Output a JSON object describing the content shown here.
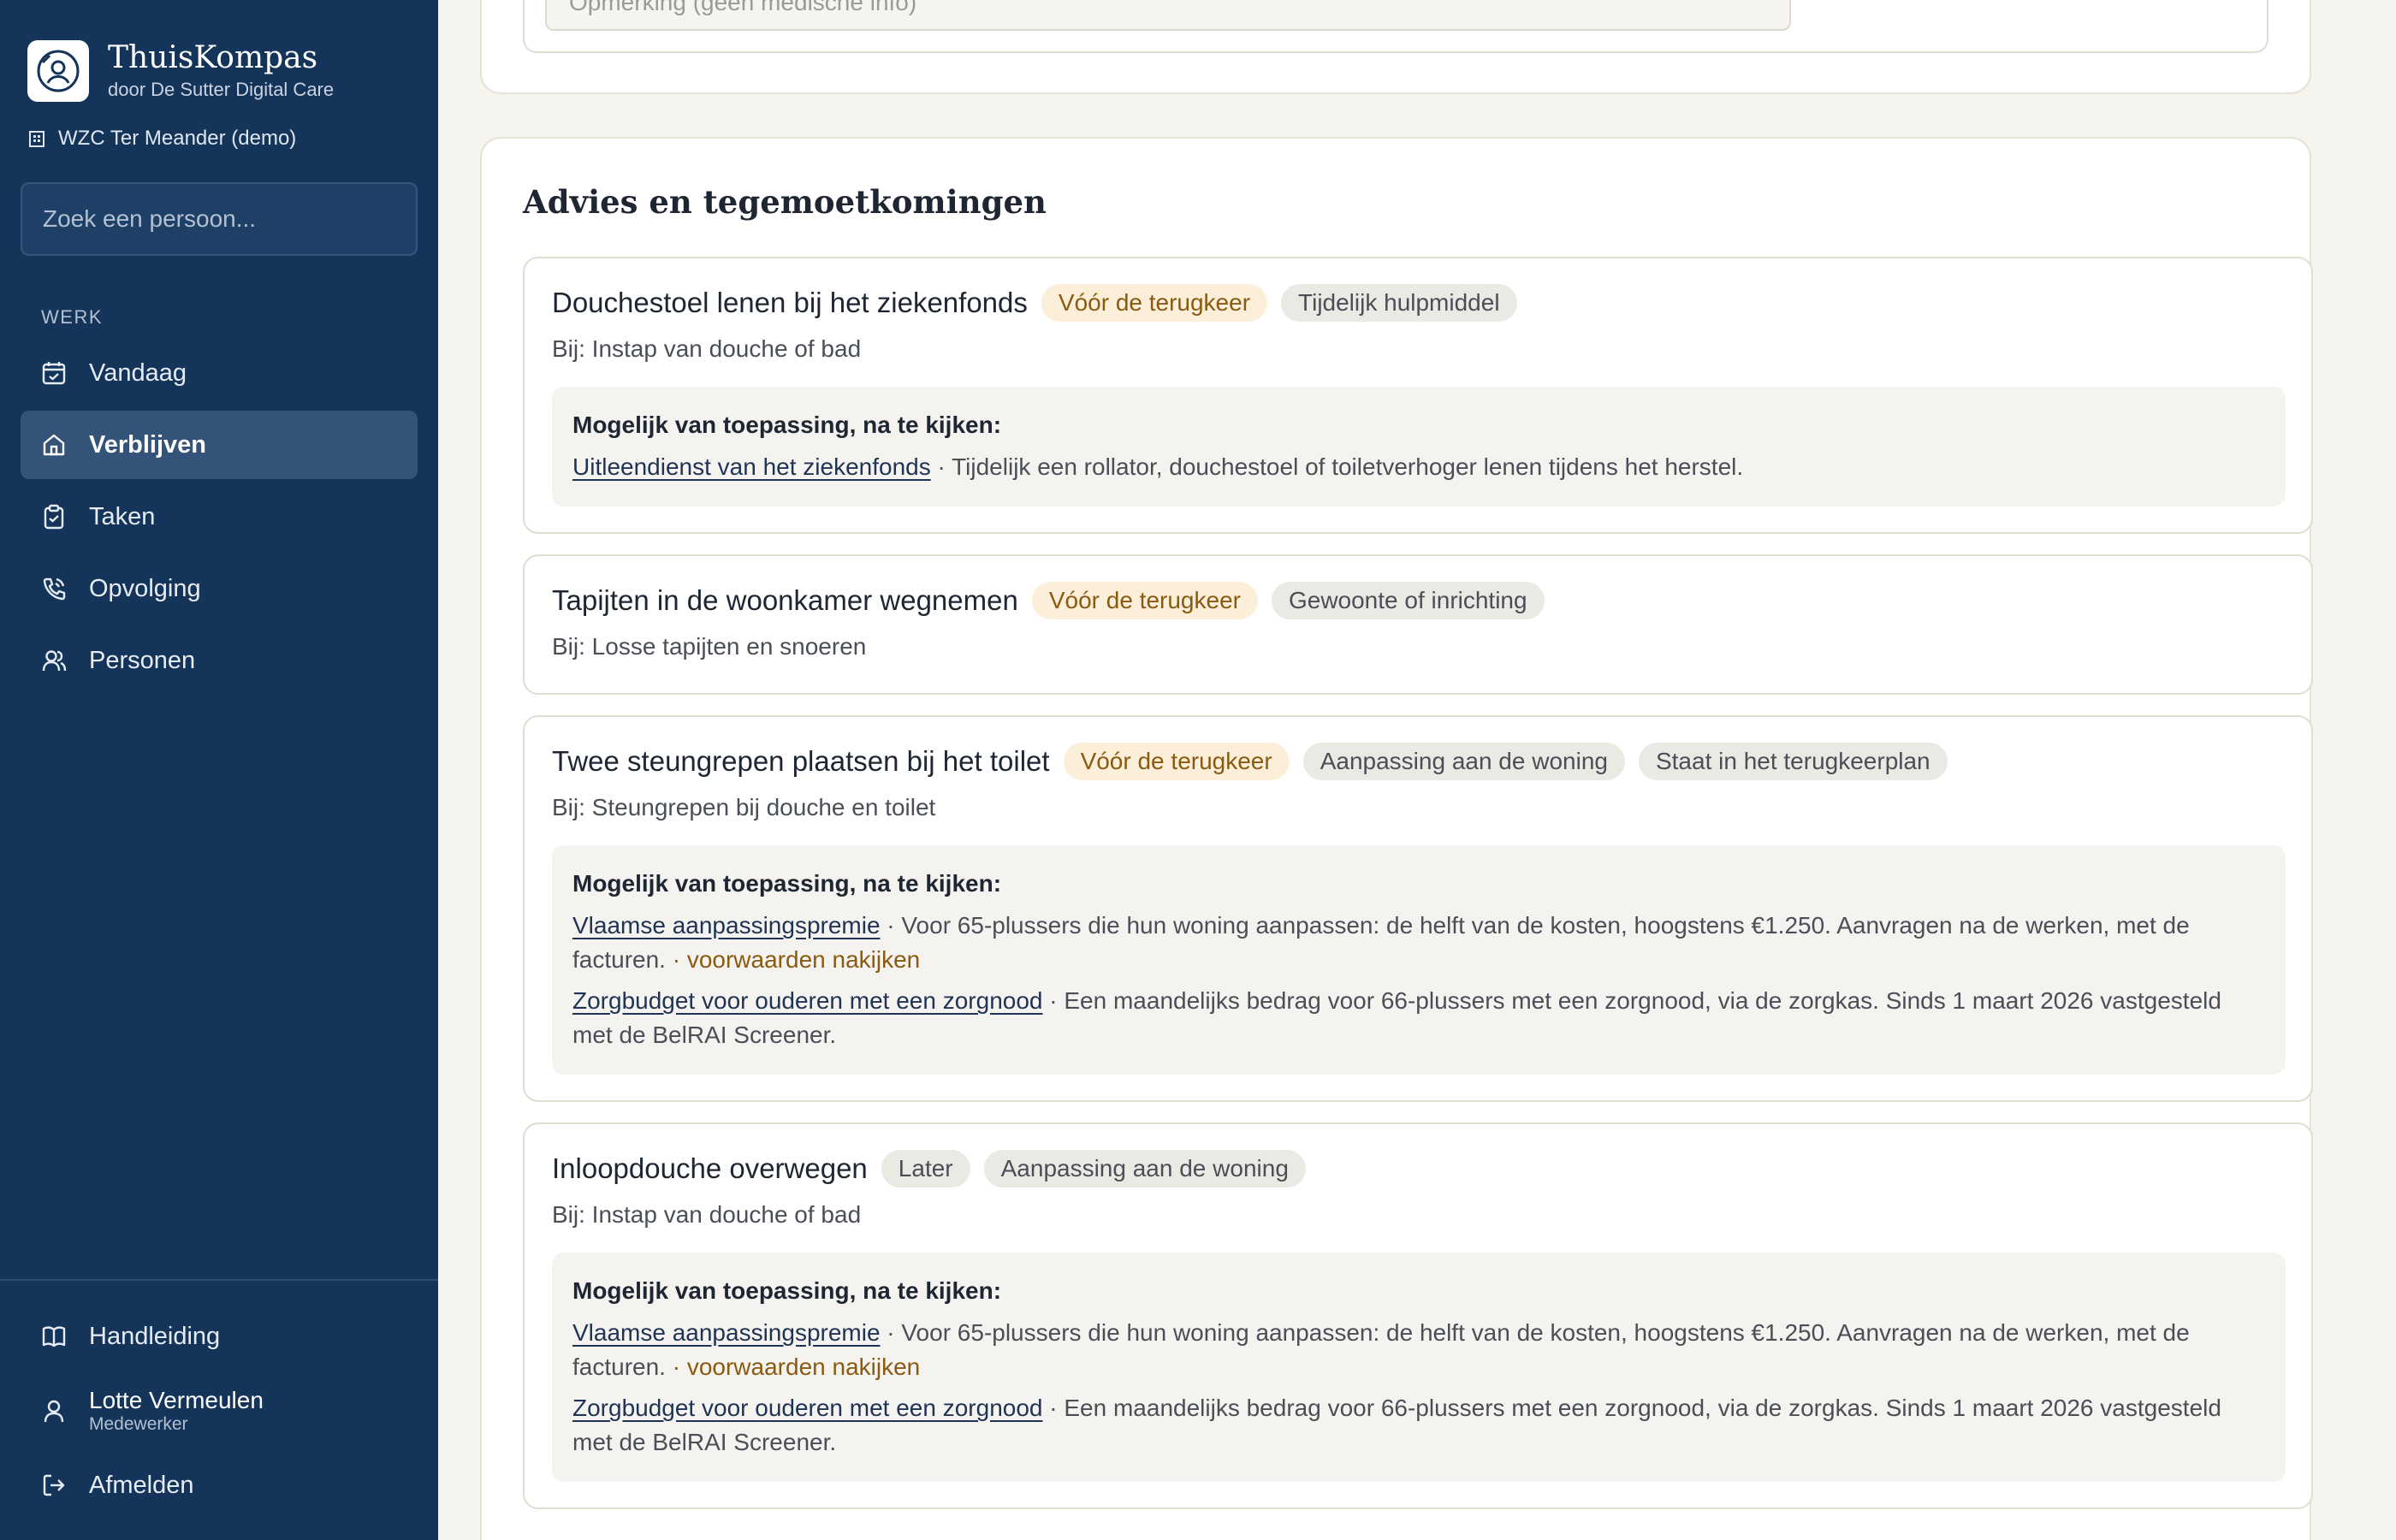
{
  "brand": {
    "title": "ThuisKompas",
    "subtitle": "door De Sutter Digital Care"
  },
  "org": {
    "name": "WZC Ter Meander (demo)"
  },
  "search": {
    "placeholder": "Zoek een persoon..."
  },
  "nav": {
    "section": "WERK",
    "items": [
      {
        "label": "Vandaag",
        "icon": "calendar-check-icon"
      },
      {
        "label": "Verblijven",
        "icon": "home-icon",
        "active": true
      },
      {
        "label": "Taken",
        "icon": "clipboard-check-icon"
      },
      {
        "label": "Opvolging",
        "icon": "phone-icon"
      },
      {
        "label": "Personen",
        "icon": "users-icon"
      }
    ]
  },
  "footer": {
    "manual": "Handleiding",
    "user": {
      "name": "Lotte Vermeulen",
      "role": "Medewerker"
    },
    "logout": "Afmelden"
  },
  "top": {
    "remark_placeholder": "Opmerking (geen medische info)"
  },
  "advice": {
    "title": "Advies en tegemoetkomingen",
    "options_heading": "Mogelijk van toepassing, na te kijken:",
    "items": [
      {
        "title": "Douchestoel lenen bij het ziekenfonds",
        "tags": [
          "Vóór de terugkeer",
          "Tijdelijk hulpmiddel"
        ],
        "sub": "Bij: Instap van douche of bad",
        "options": [
          {
            "link": "Uitleendienst van het ziekenfonds",
            "text": " · Tijdelijk een rollator, douchestoel of toiletverhoger lenen tijdens het herstel."
          }
        ]
      },
      {
        "title": "Tapijten in de woonkamer wegnemen",
        "tags": [
          "Vóór de terugkeer",
          "Gewoonte of inrichting"
        ],
        "sub": "Bij: Losse tapijten en snoeren"
      },
      {
        "title": "Twee steungrepen plaatsen bij het toilet",
        "tags": [
          "Vóór de terugkeer",
          "Aanpassing aan de woning",
          "Staat in het terugkeerplan"
        ],
        "sub": "Bij: Steungrepen bij douche en toilet",
        "options": [
          {
            "link": "Vlaamse aanpassingspremie",
            "text": " · Voor 65-plussers die hun woning aanpassen: de helft van de kosten, hoogstens €1.250. Aanvragen na de werken, met de facturen.",
            "cond": " · voorwaarden nakijken"
          },
          {
            "link": "Zorgbudget voor ouderen met een zorgnood",
            "text": " · Een maandelijks bedrag voor 66-plussers met een zorgnood, via de zorgkas. Sinds 1 maart 2026 vastgesteld met de BelRAI Screener."
          }
        ]
      },
      {
        "title": "Inloopdouche overwegen",
        "tags": [
          "Later",
          "Aanpassing aan de woning"
        ],
        "sub": "Bij: Instap van douche of bad",
        "options": [
          {
            "link": "Vlaamse aanpassingspremie",
            "text": " · Voor 65-plussers die hun woning aanpassen: de helft van de kosten, hoogstens €1.250. Aanvragen na de werken, met de facturen.",
            "cond": " · voorwaarden nakijken"
          },
          {
            "link": "Zorgbudget voor ouderen met een zorgnood",
            "text": " · Een maandelijks bedrag voor 66-plussers met een zorgnood, via de zorgkas. Sinds 1 maart 2026 vastgesteld met de BelRAI Screener."
          }
        ]
      }
    ]
  },
  "colors": {
    "sidebar": "#15345a",
    "active_nav": "#345378",
    "amber_tag_bg": "#fcefd9",
    "amber_text": "#8a5a10",
    "page_bg": "#f6f4ee"
  }
}
